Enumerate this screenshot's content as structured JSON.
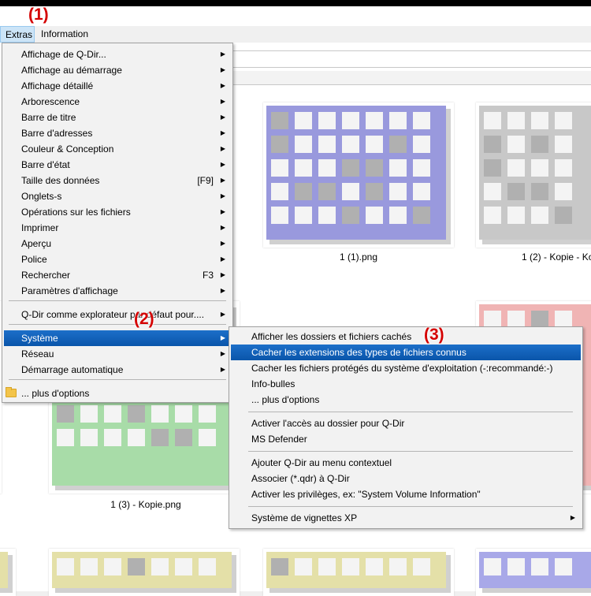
{
  "markers": [
    "(1)",
    "(2)",
    "(3)"
  ],
  "menubar": {
    "items": [
      {
        "label": "Extras"
      },
      {
        "label": "Information"
      }
    ]
  },
  "extras_menu": {
    "items": [
      {
        "label": "Affichage de Q-Dir...",
        "shortcut": "",
        "submenu": true
      },
      {
        "label": "Affichage au démarrage",
        "shortcut": "",
        "submenu": true
      },
      {
        "label": "Affichage détaillé",
        "shortcut": "",
        "submenu": true
      },
      {
        "label": "Arborescence",
        "shortcut": "",
        "submenu": true
      },
      {
        "label": "Barre de titre",
        "shortcut": "",
        "submenu": true
      },
      {
        "label": "Barre d'adresses",
        "shortcut": "",
        "submenu": true
      },
      {
        "label": "Couleur & Conception",
        "shortcut": "",
        "submenu": true
      },
      {
        "label": "Barre d'état",
        "shortcut": "",
        "submenu": true
      },
      {
        "label": "Taille des données",
        "shortcut": "[F9]",
        "submenu": true
      },
      {
        "label": "Onglets-s",
        "shortcut": "",
        "submenu": true
      },
      {
        "label": "Opérations sur les fichiers",
        "shortcut": "",
        "submenu": true
      },
      {
        "label": "Imprimer",
        "shortcut": "",
        "submenu": true
      },
      {
        "label": "Aperçu",
        "shortcut": "",
        "submenu": true
      },
      {
        "label": "Police",
        "shortcut": "",
        "submenu": true
      },
      {
        "label": "Rechercher",
        "shortcut": "F3",
        "submenu": true
      },
      {
        "label": "Paramètres d'affichage",
        "shortcut": "",
        "submenu": true
      },
      {
        "label": "Q-Dir comme explorateur par défaut pour....",
        "shortcut": "",
        "submenu": true
      },
      {
        "label": "Système",
        "shortcut": "",
        "submenu": true
      },
      {
        "label": "Réseau",
        "shortcut": "",
        "submenu": true
      },
      {
        "label": "Démarrage automatique",
        "shortcut": "",
        "submenu": true
      },
      {
        "label": "... plus d'options",
        "shortcut": "",
        "submenu": false
      }
    ]
  },
  "system_submenu": {
    "items": [
      {
        "label": "Afficher les dossiers et fichiers cachés",
        "submenu": false
      },
      {
        "label": "Cacher les extensions des types de fichiers connus",
        "submenu": false
      },
      {
        "label": "Cacher les fichiers protégés du système d'exploitation (-:recommandé:-)",
        "submenu": false
      },
      {
        "label": "Info-bulles",
        "submenu": false
      },
      {
        "label": "... plus d'options",
        "submenu": false
      },
      {
        "label": "Activer l'accès au dossier pour Q-Dir",
        "submenu": false
      },
      {
        "label": "MS Defender",
        "submenu": false
      },
      {
        "label": "Ajouter Q-Dir au menu contextuel",
        "submenu": false
      },
      {
        "label": "Associer (*.qdr) à Q-Dir",
        "submenu": false
      },
      {
        "label": "Activer les privilèges, ex: \"System Volume Information\"",
        "submenu": false
      },
      {
        "label": "Système de vignettes XP",
        "submenu": true
      }
    ]
  },
  "files": [
    {
      "name": "1 (1).png",
      "color": "#9999dd"
    },
    {
      "name": "1 (2) - Kopie - Ko",
      "color": "#c8c8c8"
    },
    {
      "name": "1 (3) - Kopie.png",
      "color": "#a8dca8"
    },
    {
      "name": "",
      "color": "#a8dca8"
    },
    {
      "name": "",
      "color": "#f0b4b4"
    },
    {
      "name": "",
      "color": "#e4e0a8"
    },
    {
      "name": "",
      "color": "#e4e0a8"
    },
    {
      "name": "",
      "color": "#e4e0a8"
    },
    {
      "name": "",
      "color": "#a8a8e8"
    }
  ],
  "colors": {
    "highlight": "#0a55aa",
    "marker": "#d40000"
  }
}
